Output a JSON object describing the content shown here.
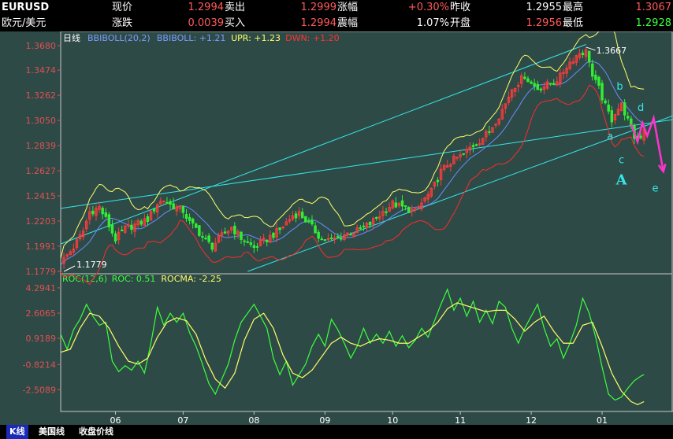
{
  "quote": {
    "symbol": "EURUSD",
    "name": "欧元/美元",
    "fields": [
      {
        "label": "现价",
        "value": "1.2994",
        "color": "red"
      },
      {
        "label": "卖出",
        "value": "1.2999",
        "color": "red"
      },
      {
        "label": "涨幅",
        "value": "+0.30%",
        "color": "red"
      },
      {
        "label": "昨收",
        "value": "1.2955",
        "color": "white"
      },
      {
        "label": "最高",
        "value": "1.3067",
        "color": "red"
      },
      {
        "label": "涨跌",
        "value": "0.0039",
        "color": "red"
      },
      {
        "label": "买入",
        "value": "1.2994",
        "color": "red"
      },
      {
        "label": "震幅",
        "value": "1.07%",
        "color": "white"
      },
      {
        "label": "开盘",
        "value": "1.2956",
        "color": "red"
      },
      {
        "label": "最低",
        "value": "1.2928",
        "color": "green"
      }
    ]
  },
  "tabs": [
    {
      "label": "K线",
      "active": true
    },
    {
      "label": "美国线",
      "active": false
    },
    {
      "label": "收盘价线",
      "active": false
    }
  ],
  "chart_data": [
    {
      "type": "candlestick",
      "period": "日线",
      "legend": [
        {
          "text": "BBIBOLL(20,2)",
          "color": "#7a9cff"
        },
        {
          "text": "BBIBOLL: +1.21",
          "color": "#7a9cff"
        },
        {
          "text": "UPR: +1.23",
          "color": "#ffff66"
        },
        {
          "text": "DWN: +1.20",
          "color": "#ff3333"
        }
      ],
      "y_ticks": [
        "1.3680",
        "1.3474",
        "1.3262",
        "1.3050",
        "1.2839",
        "1.2627",
        "1.2415",
        "1.2203",
        "1.1991",
        "1.1779"
      ],
      "ylim": [
        1.1779,
        1.368
      ],
      "x_ticks": [
        "06",
        "07",
        "08",
        "09",
        "10",
        "11",
        "12",
        "01"
      ],
      "x_tick_days": [
        17,
        38,
        60,
        82,
        103,
        124,
        146,
        168
      ],
      "days_total": 190,
      "close_anchors": [
        [
          0,
          1.185
        ],
        [
          4,
          1.198
        ],
        [
          7,
          1.212
        ],
        [
          9,
          1.228
        ],
        [
          12,
          1.232
        ],
        [
          14,
          1.222
        ],
        [
          17,
          1.205
        ],
        [
          20,
          1.214
        ],
        [
          24,
          1.218
        ],
        [
          27,
          1.222
        ],
        [
          30,
          1.235
        ],
        [
          32,
          1.238
        ],
        [
          34,
          1.234
        ],
        [
          38,
          1.229
        ],
        [
          40,
          1.219
        ],
        [
          42,
          1.214
        ],
        [
          45,
          1.204
        ],
        [
          47,
          1.199
        ],
        [
          50,
          1.208
        ],
        [
          53,
          1.215
        ],
        [
          56,
          1.206
        ],
        [
          60,
          1.198
        ],
        [
          64,
          1.205
        ],
        [
          68,
          1.213
        ],
        [
          72,
          1.225
        ],
        [
          74,
          1.227
        ],
        [
          78,
          1.215
        ],
        [
          81,
          1.205
        ],
        [
          84,
          1.204
        ],
        [
          88,
          1.209
        ],
        [
          92,
          1.212
        ],
        [
          96,
          1.218
        ],
        [
          100,
          1.228
        ],
        [
          103,
          1.235
        ],
        [
          106,
          1.232
        ],
        [
          110,
          1.228
        ],
        [
          113,
          1.239
        ],
        [
          115,
          1.245
        ],
        [
          118,
          1.262
        ],
        [
          120,
          1.268
        ],
        [
          122,
          1.272
        ],
        [
          125,
          1.276
        ],
        [
          127,
          1.282
        ],
        [
          130,
          1.288
        ],
        [
          133,
          1.296
        ],
        [
          136,
          1.309
        ],
        [
          138,
          1.319
        ],
        [
          140,
          1.332
        ],
        [
          142,
          1.337
        ],
        [
          144,
          1.343
        ],
        [
          146,
          1.336
        ],
        [
          148,
          1.332
        ],
        [
          150,
          1.334
        ],
        [
          153,
          1.337
        ],
        [
          155,
          1.342
        ],
        [
          157,
          1.351
        ],
        [
          159,
          1.357
        ],
        [
          161,
          1.362
        ],
        [
          163,
          1.363
        ],
        [
          164,
          1.356
        ],
        [
          165,
          1.342
        ],
        [
          167,
          1.332
        ],
        [
          169,
          1.317
        ],
        [
          171,
          1.306
        ],
        [
          172,
          1.312
        ],
        [
          174,
          1.318
        ],
        [
          175,
          1.312
        ],
        [
          177,
          1.298
        ],
        [
          178,
          1.291
        ],
        [
          180,
          1.292
        ],
        [
          181,
          1.299
        ]
      ],
      "annotations": [
        {
          "text": "1.3667",
          "type": "high",
          "day": 163,
          "value": 1.3667
        },
        {
          "text": "1.1779",
          "type": "low",
          "day": 1,
          "value": 1.1779
        }
      ],
      "elliott_labels": [
        {
          "text": "a",
          "day": 170.5,
          "value": 1.289,
          "color": "#33e8e8"
        },
        {
          "text": "b",
          "day": 173.5,
          "value": 1.331,
          "color": "#33e8e8"
        },
        {
          "text": "c",
          "day": 174,
          "value": 1.269,
          "color": "#33e8e8"
        },
        {
          "text": "d",
          "day": 180,
          "value": 1.313,
          "color": "#33e8e8"
        },
        {
          "text": "e",
          "day": 184.5,
          "value": 1.245,
          "color": "#33e8e8"
        },
        {
          "text": "A",
          "day": 174,
          "value": 1.251,
          "color": "#33e8e8"
        }
      ],
      "trendlines": [
        {
          "from": [
            0,
            1.231
          ],
          "to": [
            190,
            1.3057
          ]
        },
        {
          "from": [
            0,
            1.201
          ],
          "to": [
            163,
            1.369
          ]
        },
        {
          "from": [
            58,
            1.1779
          ],
          "to": [
            190,
            1.309
          ]
        }
      ],
      "projection": {
        "color": "#ff33cc",
        "points": [
          [
            177,
            1.302
          ],
          [
            179,
            1.287
          ],
          [
            180.5,
            1.303
          ],
          [
            182,
            1.292
          ],
          [
            184,
            1.307
          ],
          [
            187,
            1.262
          ]
        ]
      }
    },
    {
      "type": "line",
      "legend": [
        {
          "text": "ROC(12,6)",
          "color": "#3cff3c"
        },
        {
          "text": "ROC: 0.51",
          "color": "#3cff3c"
        },
        {
          "text": "ROCMA: -2.25",
          "color": "#ffff66"
        }
      ],
      "y_ticks": [
        "4.2941",
        "2.6065",
        "0.9189",
        "-0.8214",
        "-2.5089"
      ],
      "ylim": [
        -3.8,
        4.5
      ],
      "series": [
        {
          "name": "ROC",
          "color": "#3cff3c",
          "anchors": [
            [
              0,
              1.2
            ],
            [
              2,
              0.2
            ],
            [
              4,
              1.5
            ],
            [
              6,
              2.2
            ],
            [
              8,
              3.2
            ],
            [
              10,
              2.4
            ],
            [
              12,
              1.8
            ],
            [
              14,
              2.0
            ],
            [
              16,
              -0.6
            ],
            [
              18,
              -1.3
            ],
            [
              20,
              -0.9
            ],
            [
              22,
              -1.2
            ],
            [
              24,
              -0.6
            ],
            [
              26,
              -1.4
            ],
            [
              28,
              0.6
            ],
            [
              30,
              3.0
            ],
            [
              32,
              1.8
            ],
            [
              34,
              2.6
            ],
            [
              36,
              2.0
            ],
            [
              38,
              2.6
            ],
            [
              40,
              1.3
            ],
            [
              42,
              0.4
            ],
            [
              44,
              -0.8
            ],
            [
              46,
              -2.1
            ],
            [
              48,
              -2.8
            ],
            [
              50,
              -1.8
            ],
            [
              52,
              -0.8
            ],
            [
              54,
              0.8
            ],
            [
              56,
              2.0
            ],
            [
              58,
              2.6
            ],
            [
              60,
              3.2
            ],
            [
              62,
              2.4
            ],
            [
              64,
              1.6
            ],
            [
              66,
              -0.4
            ],
            [
              68,
              -1.5
            ],
            [
              70,
              -0.6
            ],
            [
              72,
              -2.2
            ],
            [
              74,
              -1.5
            ],
            [
              76,
              -0.8
            ],
            [
              78,
              0.4
            ],
            [
              80,
              1.2
            ],
            [
              82,
              0.4
            ],
            [
              84,
              2.2
            ],
            [
              86,
              1.5
            ],
            [
              88,
              0.6
            ],
            [
              90,
              -0.4
            ],
            [
              92,
              0.4
            ],
            [
              94,
              1.6
            ],
            [
              96,
              0.6
            ],
            [
              98,
              1.2
            ],
            [
              100,
              0.6
            ],
            [
              102,
              1.4
            ],
            [
              104,
              0.4
            ],
            [
              106,
              1.1
            ],
            [
              108,
              0.3
            ],
            [
              110,
              0.8
            ],
            [
              112,
              1.6
            ],
            [
              114,
              1.0
            ],
            [
              116,
              2.1
            ],
            [
              118,
              3.2
            ],
            [
              120,
              4.2
            ],
            [
              122,
              2.8
            ],
            [
              124,
              3.6
            ],
            [
              126,
              2.4
            ],
            [
              128,
              3.4
            ],
            [
              130,
              2.0
            ],
            [
              132,
              2.8
            ],
            [
              134,
              1.9
            ],
            [
              136,
              3.4
            ],
            [
              138,
              3.0
            ],
            [
              140,
              1.6
            ],
            [
              142,
              0.6
            ],
            [
              144,
              1.6
            ],
            [
              146,
              2.4
            ],
            [
              148,
              3.2
            ],
            [
              150,
              1.6
            ],
            [
              152,
              0.4
            ],
            [
              154,
              0.9
            ],
            [
              156,
              -0.4
            ],
            [
              158,
              0.6
            ],
            [
              160,
              1.8
            ],
            [
              162,
              3.6
            ],
            [
              164,
              2.6
            ],
            [
              166,
              1.0
            ],
            [
              168,
              -1.0
            ],
            [
              170,
              -2.8
            ],
            [
              172,
              -3.2
            ],
            [
              174,
              -3.0
            ],
            [
              176,
              -2.4
            ],
            [
              178,
              -1.9
            ],
            [
              180,
              -1.6
            ],
            [
              181,
              -1.5
            ]
          ]
        },
        {
          "name": "ROCMA",
          "color": "#ffff66",
          "anchors": [
            [
              0,
              0.0
            ],
            [
              3,
              0.2
            ],
            [
              6,
              1.6
            ],
            [
              9,
              2.6
            ],
            [
              12,
              2.4
            ],
            [
              15,
              1.6
            ],
            [
              18,
              0.4
            ],
            [
              21,
              -0.6
            ],
            [
              24,
              -0.8
            ],
            [
              27,
              -0.4
            ],
            [
              30,
              1.0
            ],
            [
              33,
              2.0
            ],
            [
              36,
              2.3
            ],
            [
              39,
              2.1
            ],
            [
              42,
              1.2
            ],
            [
              45,
              -0.5
            ],
            [
              48,
              -1.8
            ],
            [
              51,
              -2.4
            ],
            [
              54,
              -1.4
            ],
            [
              57,
              0.8
            ],
            [
              60,
              2.2
            ],
            [
              63,
              2.6
            ],
            [
              66,
              1.6
            ],
            [
              69,
              -0.2
            ],
            [
              72,
              -1.4
            ],
            [
              75,
              -1.7
            ],
            [
              78,
              -1.2
            ],
            [
              81,
              -0.3
            ],
            [
              84,
              0.6
            ],
            [
              87,
              1.0
            ],
            [
              90,
              0.6
            ],
            [
              93,
              0.4
            ],
            [
              96,
              0.7
            ],
            [
              99,
              0.9
            ],
            [
              102,
              0.8
            ],
            [
              105,
              0.6
            ],
            [
              108,
              0.6
            ],
            [
              111,
              1.0
            ],
            [
              114,
              1.4
            ],
            [
              117,
              2.0
            ],
            [
              120,
              2.9
            ],
            [
              123,
              3.3
            ],
            [
              126,
              3.1
            ],
            [
              129,
              2.9
            ],
            [
              132,
              2.7
            ],
            [
              135,
              2.8
            ],
            [
              138,
              2.8
            ],
            [
              141,
              2.2
            ],
            [
              144,
              1.4
            ],
            [
              147,
              2.0
            ],
            [
              150,
              2.4
            ],
            [
              153,
              1.4
            ],
            [
              156,
              0.6
            ],
            [
              159,
              0.6
            ],
            [
              162,
              1.8
            ],
            [
              165,
              2.0
            ],
            [
              168,
              0.4
            ],
            [
              171,
              -1.4
            ],
            [
              174,
              -2.6
            ],
            [
              177,
              -3.3
            ],
            [
              179,
              -3.5
            ],
            [
              181,
              -3.3
            ]
          ]
        }
      ]
    }
  ]
}
